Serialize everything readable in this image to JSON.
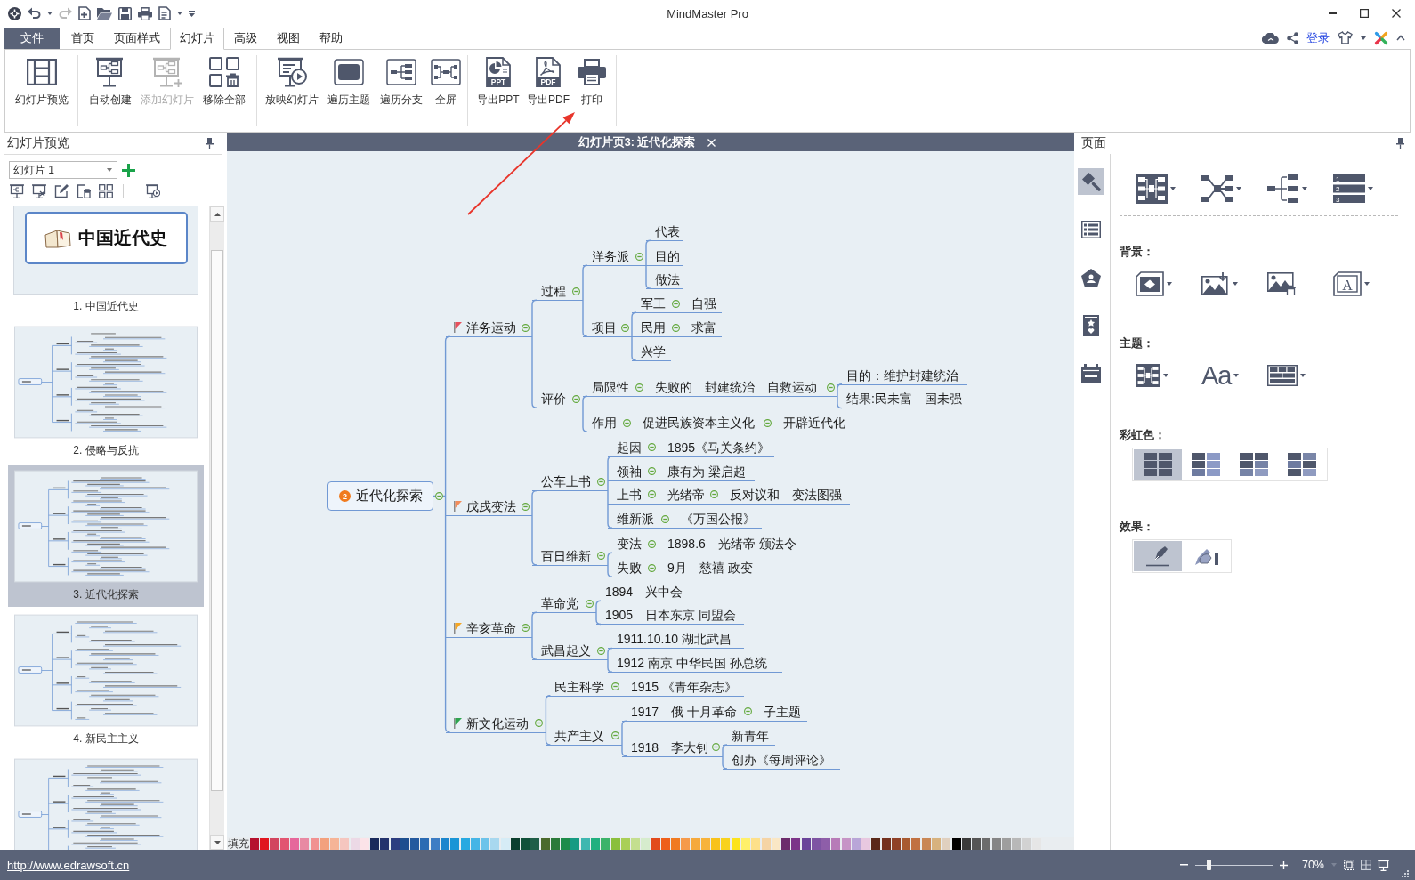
{
  "window": {
    "title": "MindMaster Pro"
  },
  "menu": {
    "file": "文件",
    "tabs": [
      {
        "label": "首页",
        "selected": false
      },
      {
        "label": "页面样式",
        "selected": false
      },
      {
        "label": "幻灯片",
        "selected": true
      },
      {
        "label": "高级",
        "selected": false
      },
      {
        "label": "视图",
        "selected": false
      },
      {
        "label": "帮助",
        "selected": false
      }
    ],
    "login": "登录"
  },
  "ribbon": {
    "groups": [
      {
        "buttons": [
          {
            "label": "幻灯片预览",
            "disabled": false
          }
        ]
      },
      {
        "buttons": [
          {
            "label": "自动创建",
            "disabled": false
          },
          {
            "label": "添加幻灯片",
            "disabled": true
          },
          {
            "label": "移除全部",
            "disabled": false
          }
        ]
      },
      {
        "buttons": [
          {
            "label": "放映幻灯片",
            "disabled": false
          },
          {
            "label": "遍历主题",
            "disabled": false
          },
          {
            "label": "遍历分支",
            "disabled": false
          },
          {
            "label": "全屏",
            "disabled": false
          }
        ]
      },
      {
        "buttons": [
          {
            "label": "导出PPT",
            "disabled": false,
            "icon_text": "PPT"
          },
          {
            "label": "导出PDF",
            "disabled": false,
            "icon_text": "PDF"
          },
          {
            "label": "打印",
            "disabled": false
          }
        ]
      }
    ]
  },
  "left_panel": {
    "title": "幻灯片预览",
    "dropdown": "幻灯片 1",
    "slides": [
      {
        "kind": "title",
        "title": "中国近代史",
        "label": "1. 中国近代史",
        "selected": false
      },
      {
        "kind": "map",
        "label": "2. 侵略与反抗",
        "selected": false
      },
      {
        "kind": "map",
        "label": "3. 近代化探索",
        "selected": true
      },
      {
        "kind": "map",
        "label": "4. 新民主主义",
        "selected": false
      },
      {
        "kind": "map",
        "selected": false
      }
    ]
  },
  "canvas": {
    "tab_title": "幻灯片页3: 近代化探索",
    "mind_map": {
      "root": {
        "text": "近代化探索",
        "priority": "2",
        "expanded": true,
        "children": [
          {
            "text": "洋务运动",
            "color": "#e8505c",
            "expanded": true,
            "children": [
              {
                "text": "过程",
                "expanded": true,
                "children": [
                  {
                    "text": "洋务派",
                    "expanded": true,
                    "children": [
                      {
                        "text": "代表"
                      },
                      {
                        "text": "目的"
                      },
                      {
                        "text": "做法"
                      }
                    ]
                  },
                  {
                    "text": "项目",
                    "expanded": true,
                    "children": [
                      {
                        "text": "军工",
                        "expanded": true,
                        "children": [
                          {
                            "text": "自强"
                          }
                        ]
                      },
                      {
                        "text": "民用",
                        "expanded": true,
                        "children": [
                          {
                            "text": "求富"
                          }
                        ]
                      },
                      {
                        "text": "兴学"
                      }
                    ]
                  }
                ]
              },
              {
                "text": "评价",
                "expanded": true,
                "children": [
                  {
                    "text": "局限性",
                    "expanded": true,
                    "children": [
                      {
                        "text": "失败的　封建统治　自救运动",
                        "expanded": true,
                        "children": [
                          {
                            "text": "目的：维护封建统治"
                          },
                          {
                            "text": "结果:民未富　国未强"
                          }
                        ]
                      }
                    ]
                  },
                  {
                    "text": "作用",
                    "expanded": true,
                    "children": [
                      {
                        "text": "促进民族资本主义化",
                        "expanded": true,
                        "children": [
                          {
                            "text": "开辟近代化"
                          }
                        ]
                      }
                    ]
                  }
                ]
              }
            ]
          },
          {
            "text": "戊戌变法",
            "color": "#f28c5a",
            "expanded": true,
            "children": [
              {
                "text": "公车上书",
                "expanded": true,
                "children": [
                  {
                    "text": "起因",
                    "expanded": true,
                    "children": [
                      {
                        "text": "1895《马关条约》"
                      }
                    ]
                  },
                  {
                    "text": "领袖",
                    "expanded": true,
                    "children": [
                      {
                        "text": "康有为 梁启超"
                      }
                    ]
                  },
                  {
                    "text": "上书",
                    "expanded": true,
                    "children": [
                      {
                        "text": "光绪帝",
                        "expanded": true,
                        "children": [
                          {
                            "text": "反对议和　变法图强"
                          }
                        ]
                      }
                    ]
                  },
                  {
                    "text": "维新派",
                    "expanded": true,
                    "children": [
                      {
                        "text": "《万国公报》"
                      }
                    ]
                  }
                ]
              },
              {
                "text": "百日维新",
                "expanded": true,
                "children": [
                  {
                    "text": "变法",
                    "expanded": true,
                    "children": [
                      {
                        "text": "1898.6　光绪帝 颁法令"
                      }
                    ]
                  },
                  {
                    "text": "失败",
                    "expanded": true,
                    "children": [
                      {
                        "text": "9月　慈禧 政变"
                      }
                    ]
                  }
                ]
              }
            ]
          },
          {
            "text": "辛亥革命",
            "color": "#f5a623",
            "expanded": true,
            "children": [
              {
                "text": "革命党",
                "expanded": true,
                "children": [
                  {
                    "text": "1894　兴中会"
                  },
                  {
                    "text": "1905　日本东京 同盟会"
                  }
                ]
              },
              {
                "text": "武昌起义",
                "expanded": true,
                "children": [
                  {
                    "text": "1911.10.10 湖北武昌"
                  },
                  {
                    "text": "1912 南京 中华民国 孙总统"
                  }
                ]
              }
            ]
          },
          {
            "text": "新文化运动",
            "color": "#2ea44f",
            "expanded": true,
            "children": [
              {
                "text": "民主科学",
                "expanded": true,
                "children": [
                  {
                    "text": "1915 《青年杂志》"
                  }
                ]
              },
              {
                "text": "共产主义",
                "expanded": true,
                "children": [
                  {
                    "text": "1917　俄 十月革命",
                    "expanded": true,
                    "children": [
                      {
                        "text": "子主题"
                      }
                    ]
                  },
                  {
                    "text": "1918　李大钊",
                    "expanded": true,
                    "children": [
                      {
                        "text": "新青年"
                      },
                      {
                        "text": "创办《每周评论》"
                      }
                    ]
                  }
                ]
              }
            ]
          }
        ]
      }
    },
    "palette": {
      "label": "填充",
      "swatches": [
        {
          "color": "#b5112e"
        },
        {
          "color": "#e0161f"
        },
        {
          "color": "#d2455f"
        },
        {
          "color": "#e25571"
        },
        {
          "color": "#e6679b"
        },
        {
          "color": "#e889a3"
        },
        {
          "color": "#f19191"
        },
        {
          "color": "#f3a17e"
        },
        {
          "color": "#f6b497"
        },
        {
          "color": "#f5c6bf"
        },
        {
          "color": "#ecd9e6"
        },
        {
          "color": "#fbe3e8"
        },
        {
          "color": "#1a2a5c"
        },
        {
          "color": "#23336d"
        },
        {
          "color": "#2c3d80"
        },
        {
          "color": "#1d4f8f"
        },
        {
          "color": "#23599e"
        },
        {
          "color": "#2a6bb3"
        },
        {
          "color": "#3d7dc4"
        },
        {
          "color": "#1b86cd"
        },
        {
          "color": "#1a95d6"
        },
        {
          "color": "#27a9e1"
        },
        {
          "color": "#45b5e6"
        },
        {
          "color": "#6cc3ea"
        },
        {
          "color": "#a8d8ef"
        },
        {
          "color": "#d6ecf6"
        },
        {
          "color": "#0b3f2e"
        },
        {
          "color": "#10513a"
        },
        {
          "color": "#1f5e48"
        },
        {
          "color": "#4a6a2c"
        },
        {
          "color": "#2a7a3a"
        },
        {
          "color": "#1d8c4a"
        },
        {
          "color": "#169b83"
        },
        {
          "color": "#3fb7b0"
        },
        {
          "color": "#21b07f"
        },
        {
          "color": "#3bb36a"
        },
        {
          "color": "#8abf3c"
        },
        {
          "color": "#a9cf57"
        },
        {
          "color": "#c4df8f"
        },
        {
          "color": "#d6eccd"
        },
        {
          "color": "#e24a1c"
        },
        {
          "color": "#ee5f1a"
        },
        {
          "color": "#f07a21"
        },
        {
          "color": "#f59a4a"
        },
        {
          "color": "#f5a93c"
        },
        {
          "color": "#f7b33b"
        },
        {
          "color": "#f8c21b"
        },
        {
          "color": "#f8d21e"
        },
        {
          "color": "#fce31c"
        },
        {
          "color": "#fff06a"
        },
        {
          "color": "#fde08a"
        },
        {
          "color": "#f5d4a5"
        },
        {
          "color": "#fae7c5"
        },
        {
          "color": "#6c2c6c"
        },
        {
          "color": "#7c3489"
        },
        {
          "color": "#6a449a"
        },
        {
          "color": "#7e54a3"
        },
        {
          "color": "#8e5ea9"
        },
        {
          "color": "#b77bb8"
        },
        {
          "color": "#c694c6"
        },
        {
          "color": "#b9a6d8"
        },
        {
          "color": "#e8c8e0"
        },
        {
          "color": "#5a2919"
        },
        {
          "color": "#74311f"
        },
        {
          "color": "#8f4127"
        },
        {
          "color": "#a85a30"
        },
        {
          "color": "#c17141"
        },
        {
          "color": "#c98755"
        },
        {
          "color": "#d7b27e"
        },
        {
          "color": "#e0d0bf"
        },
        {
          "color": "#000000"
        },
        {
          "color": "#3a3a3a"
        },
        {
          "color": "#555555"
        },
        {
          "color": "#6c6c6c"
        },
        {
          "color": "#858585"
        },
        {
          "color": "#9e9e9e"
        },
        {
          "color": "#b8b8b8"
        },
        {
          "color": "#d2d2d2"
        },
        {
          "color": "#e6e6e6"
        }
      ]
    }
  },
  "right_panel": {
    "title": "页面",
    "side_tabs": [
      {
        "selected": true
      },
      {
        "selected": false
      },
      {
        "selected": false
      },
      {
        "selected": false
      },
      {
        "selected": false
      }
    ],
    "layout_numbers": [
      "1",
      "2",
      "3"
    ],
    "sections": [
      {
        "kind": "background",
        "label": "背景：",
        "glyph": "A"
      },
      {
        "kind": "theme",
        "label": "主题：",
        "glyph": "Aa"
      },
      {
        "kind": "rainbow",
        "label": "彩虹色：",
        "options": [
          {
            "selected": true
          },
          {
            "selected": false
          },
          {
            "selected": false
          },
          {
            "selected": false
          }
        ]
      },
      {
        "kind": "effect",
        "label": "效果：",
        "options": [
          {
            "selected": true
          },
          {
            "selected": false
          }
        ]
      }
    ]
  },
  "status_bar": {
    "link": "http://www.edrawsoft.cn",
    "zoom": {
      "level": 0.17,
      "reading": "70%"
    }
  }
}
